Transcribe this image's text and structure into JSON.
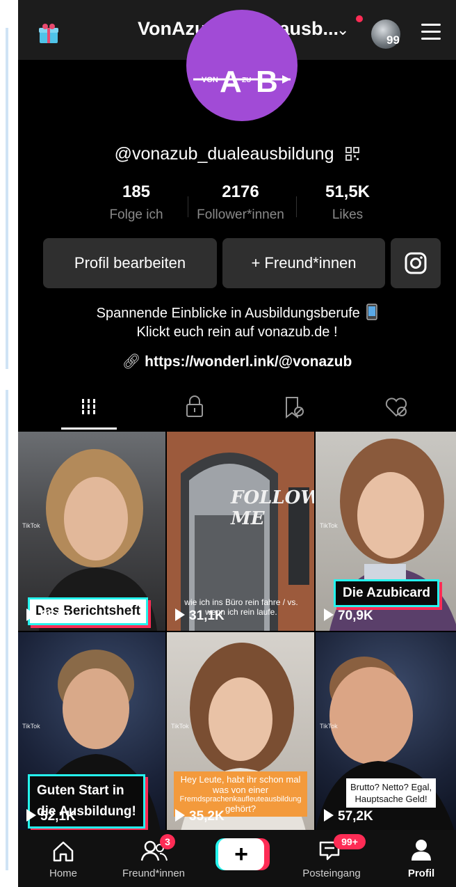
{
  "header": {
    "title": "VonAzuB_dualeausb...",
    "notification_count": "99",
    "icons": [
      "gift-icon",
      "chevron-down-icon",
      "avatar",
      "menu-icon"
    ]
  },
  "logo": {
    "text": "VON A ZU B"
  },
  "profile": {
    "handle": "@vonazub_dualeausbildung",
    "stats": [
      {
        "value": "185",
        "label": "Folge ich"
      },
      {
        "value": "2176",
        "label": "Follower*innen"
      },
      {
        "value": "51,5K",
        "label": "Likes"
      }
    ],
    "buttons": {
      "edit": "Profil bearbeiten",
      "friends": "+ Freund*innen"
    },
    "bio_line1": "Spannende Einblicke in Ausbildungsberufe",
    "bio_line2": "Klickt euch rein auf vonazub.de !",
    "link": "https://wonderl.ink/@vonazub"
  },
  "tabs": [
    "videos-tab",
    "private-tab",
    "reposts-tab",
    "liked-tab"
  ],
  "videos": [
    {
      "caption": "Das Berichtsheft",
      "views": "9540"
    },
    {
      "caption": "wie ich ins Büro rein fahre / vs. wenn ich rein laufe.",
      "overlay": "FOLLOW ME",
      "views": "31,1K"
    },
    {
      "caption": "Die Azubicard",
      "views": "70,9K"
    },
    {
      "caption_line1": "Guten Start in",
      "caption_line2": "die Ausbildung!",
      "views": "52,1K"
    },
    {
      "caption_line1": "Hey Leute, habt ihr schon mal",
      "caption_line2": "was von einer",
      "caption_line3": "Fremdsprachenkaufleuteausbildung",
      "caption_line4": "gehört?",
      "views": "35,2K"
    },
    {
      "caption_line1": "Brutto? Netto? Egal,",
      "caption_line2": "Hauptsache Geld!",
      "views": "57,2K"
    }
  ],
  "tiktok_watermark": "TikTok",
  "nav": {
    "home": "Home",
    "friends": "Freund*innen",
    "friends_badge": "3",
    "inbox": "Posteingang",
    "inbox_badge": "99+",
    "profile": "Profil"
  },
  "colors": {
    "accent": "#fe2c55",
    "cyan": "#25f4ee",
    "logo_bg": "#a14bd6"
  }
}
